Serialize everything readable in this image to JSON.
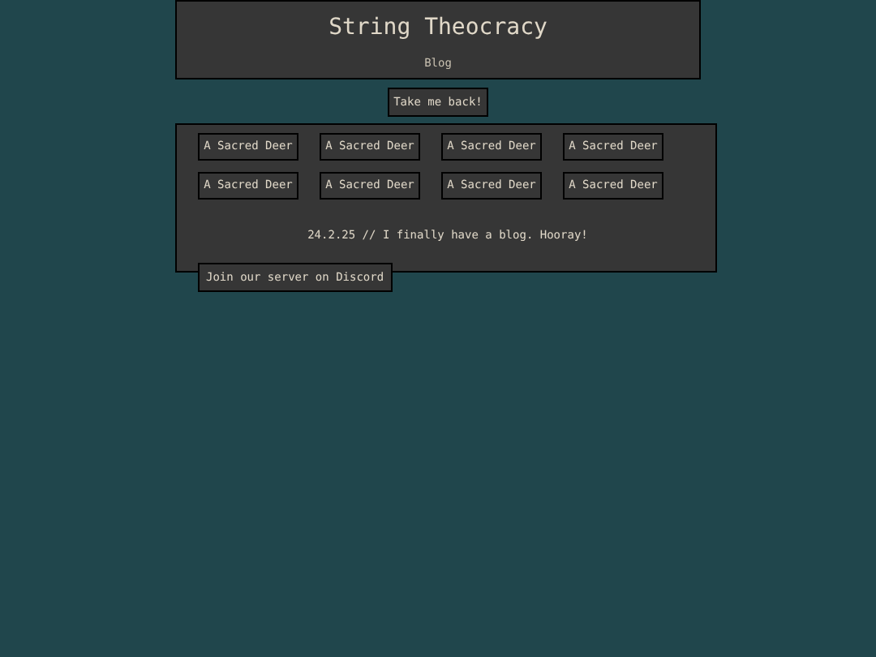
{
  "header": {
    "title": "String Theocracy",
    "subtitle": "Blog"
  },
  "back_button": "Take me back!",
  "posts": [
    {
      "label": "A Sacred Deer"
    },
    {
      "label": "A Sacred Deer"
    },
    {
      "label": "A Sacred Deer"
    },
    {
      "label": "A Sacred Deer"
    },
    {
      "label": "A Sacred Deer"
    },
    {
      "label": "A Sacred Deer"
    },
    {
      "label": "A Sacred Deer"
    },
    {
      "label": "A Sacred Deer"
    }
  ],
  "announcement": "24.2.25 // I finally have a blog. Hooray!",
  "discord_button": "Join our server on Discord"
}
